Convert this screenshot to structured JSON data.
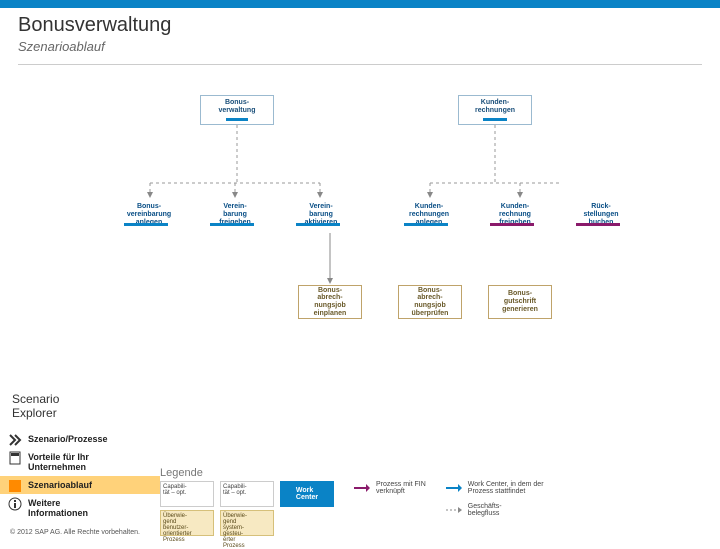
{
  "header": {
    "title": "Bonusverwaltung",
    "subtitle": "Szenarioablauf"
  },
  "entry_nodes": {
    "bonus": "Bonus-\nverwaltung",
    "kunden": "Kunden-\nrechnungen"
  },
  "steps": {
    "s1": "Bonus-\nvereinbarung\nanlegen",
    "s2": "Verein-\nbarung\nfreigeben",
    "s3": "Verein-\nbarung\naktivieren",
    "s4": "Kunden-\nrechnungen\nanlegen",
    "s5": "Kunden-\nrechnung\nfreigeben",
    "s6": "Rück-\nstellungen\nbuchen"
  },
  "subs": {
    "b1": "Bonus-\nabrech-\nnungsjob\neinplanen",
    "b2": "Bonus-\nabrech-\nnungsjob\nüberprüfen",
    "b3": "Bonus-\ngutschrift\ngenerieren"
  },
  "nav": {
    "explorer": "Scenario\nExplorer",
    "item1": "Szenario/Prozesse",
    "item2": "Vorteile für Ihr\nUnternehmen",
    "item3": "Szenarioablauf",
    "item4": "Weitere\nInformationen"
  },
  "legend": {
    "title": "Legende",
    "cap_opt": "Capabili-\ntät – opt.",
    "cap_opt2": "Capabili-\ntät – opt.",
    "user_proc": "Überwie-\ngend\nbenutzer-\norientierter\nProzess",
    "sys_proc": "Überwie-\ngend\nsystem-\ngesteu-\nerter\nProzess",
    "work_center": "Work\nCenter",
    "fin_link": "Prozess mit FIN\nverknüpft",
    "wc_desc": "Work Center, in dem der\nProzess stattfindet",
    "biz_doc": "Geschäfts-\nbelegfluss"
  },
  "footer": {
    "copyright": "© 2012 SAP AG. Alle Rechte vorbehalten."
  }
}
